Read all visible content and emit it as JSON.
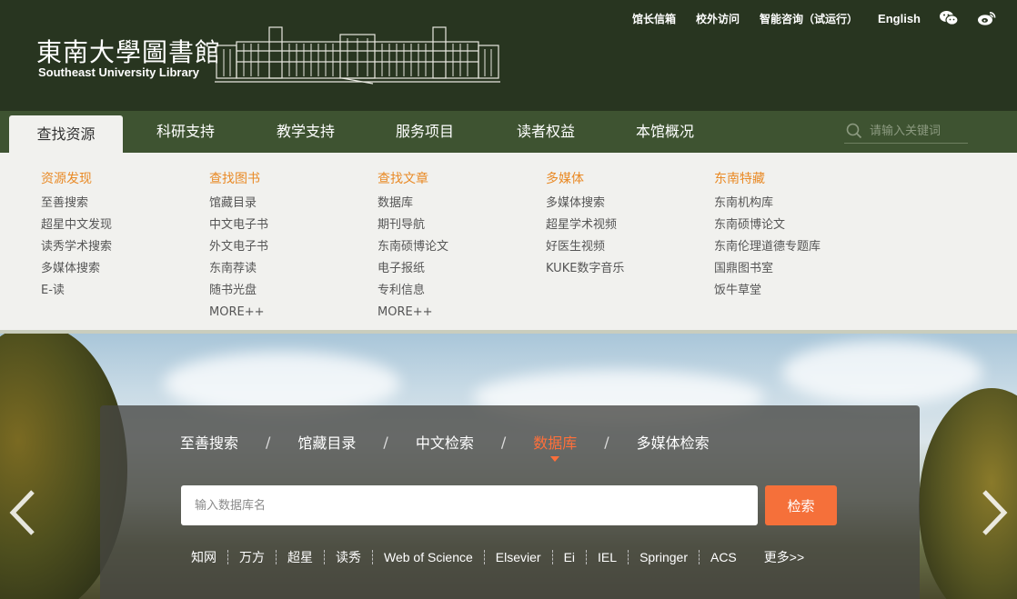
{
  "header": {
    "logo_cn": "東南大學圖書館",
    "logo_en": "Southeast University Library",
    "top_links": [
      "馆长信箱",
      "校外访问",
      "智能咨询（试运行）",
      "English"
    ],
    "icons": [
      "wechat-icon",
      "weibo-icon"
    ]
  },
  "nav": {
    "items": [
      "查找资源",
      "科研支持",
      "教学支持",
      "服务项目",
      "读者权益",
      "本馆概况"
    ],
    "active_index": 0,
    "search_placeholder": "请输入关键词"
  },
  "dropdown": {
    "columns": [
      {
        "title": "资源发现",
        "links": [
          "至善搜索",
          "超星中文发现",
          "读秀学术搜索",
          "多媒体搜索",
          "E-读"
        ]
      },
      {
        "title": "查找图书",
        "links": [
          "馆藏目录",
          "中文电子书",
          "外文电子书",
          "东南荐读",
          "随书光盘",
          "MORE++"
        ]
      },
      {
        "title": "查找文章",
        "links": [
          "数据库",
          "期刊导航",
          "东南硕博论文",
          "电子报纸",
          "专利信息",
          "MORE++"
        ]
      },
      {
        "title": "多媒体",
        "links": [
          "多媒体搜索",
          "超星学术视频",
          "好医生视频",
          "KUKE数字音乐"
        ]
      },
      {
        "title": "东南特藏",
        "links": [
          "东南机构库",
          "东南硕博论文",
          "东南伦理道德专题库",
          "国鼎图书室",
          "饭牛草堂"
        ]
      }
    ]
  },
  "search": {
    "tabs": [
      "至善搜索",
      "馆藏目录",
      "中文检索",
      "数据库",
      "多媒体检索"
    ],
    "active_tab": 3,
    "separator": "/",
    "placeholder": "输入数据库名",
    "button": "检索",
    "quick_links": [
      "知网",
      "万方",
      "超星",
      "读秀",
      "Web of Science",
      "Elsevier",
      "Ei",
      "IEL",
      "Springer",
      "ACS"
    ],
    "more": "更多>>"
  },
  "colors": {
    "header_bg": "#283520",
    "nav_bg": "#3e5331",
    "accent_orange": "#e98a26",
    "button_orange": "#f5703a"
  }
}
